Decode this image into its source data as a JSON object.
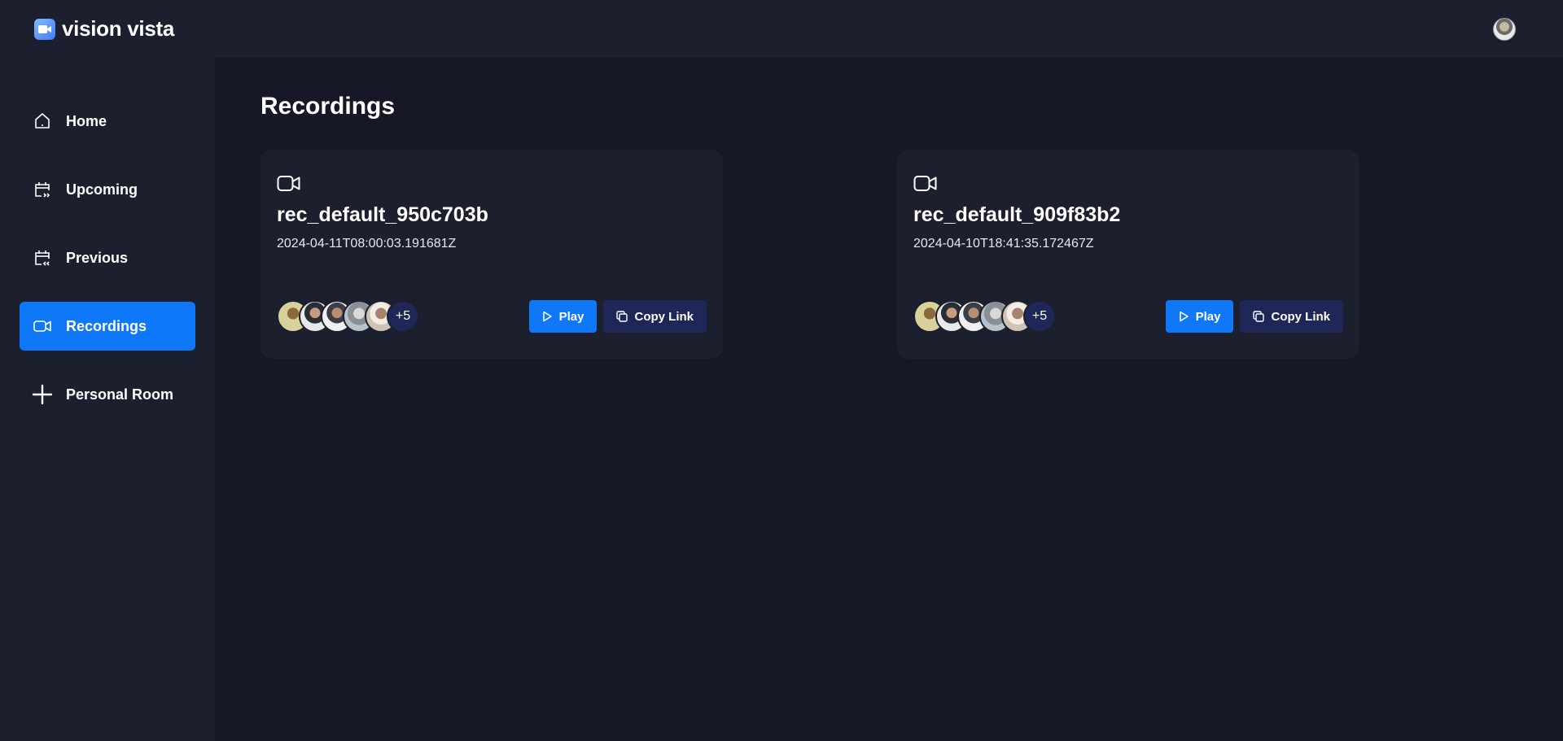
{
  "brand": {
    "name": "vision vista"
  },
  "nav": [
    {
      "label": "Home"
    },
    {
      "label": "Upcoming"
    },
    {
      "label": "Previous"
    },
    {
      "label": "Recordings"
    },
    {
      "label": "Personal Room"
    }
  ],
  "page": {
    "title": "Recordings"
  },
  "recordings": [
    {
      "title": "rec_default_950c703b",
      "date": "2024-04-11T08:00:03.191681Z",
      "more_count": "+5",
      "play_label": "Play",
      "copy_label": "Copy Link"
    },
    {
      "title": "rec_default_909f83b2",
      "date": "2024-04-10T18:41:35.172467Z",
      "more_count": "+5",
      "play_label": "Play",
      "copy_label": "Copy Link"
    }
  ],
  "colors": {
    "accent": "#0e78f9",
    "panel": "#1c1f2e",
    "background": "#161925",
    "secondary_button": "#1e2757"
  },
  "icons": [
    "video-camera-icon",
    "home-icon",
    "calendar-upcoming-icon",
    "calendar-previous-icon",
    "plus-icon",
    "play-icon",
    "copy-icon"
  ]
}
